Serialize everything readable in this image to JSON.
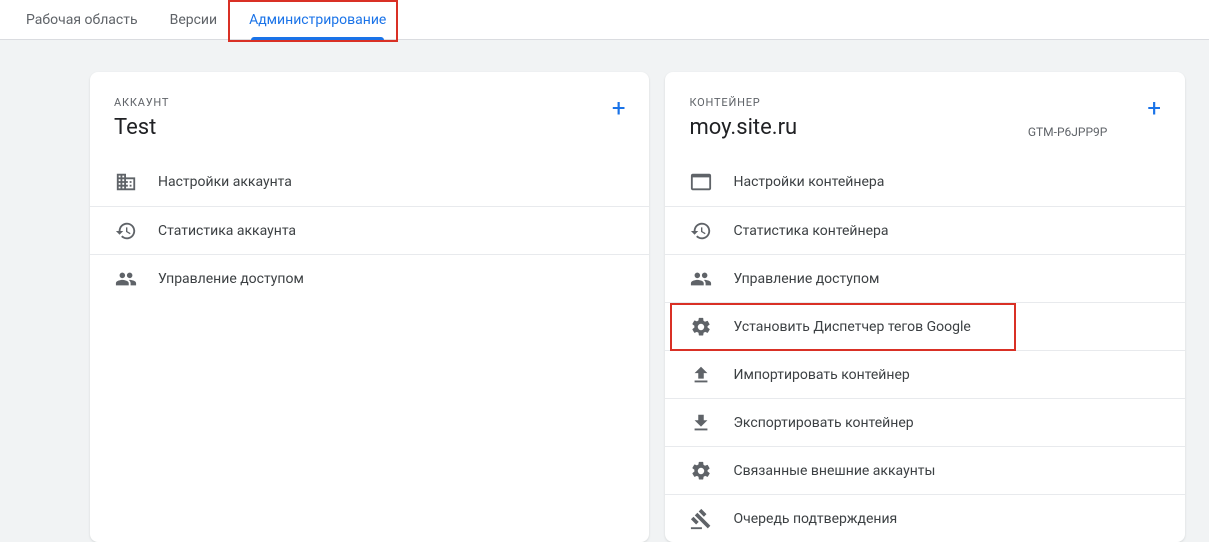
{
  "tabs": {
    "workspace": "Рабочая область",
    "versions": "Версии",
    "admin": "Администрирование"
  },
  "account": {
    "section_label": "АККАУНТ",
    "title": "Test",
    "items": [
      {
        "label": "Настройки аккаунта"
      },
      {
        "label": "Статистика аккаунта"
      },
      {
        "label": "Управление доступом"
      }
    ]
  },
  "container": {
    "section_label": "КОНТЕЙНЕР",
    "title": "moy.site.ru",
    "id": "GTM-P6JPP9P",
    "items": [
      {
        "label": "Настройки контейнера"
      },
      {
        "label": "Статистика контейнера"
      },
      {
        "label": "Управление доступом"
      },
      {
        "label": "Установить Диспетчер тегов Google"
      },
      {
        "label": "Импортировать контейнер"
      },
      {
        "label": "Экспортировать контейнер"
      },
      {
        "label": "Связанные внешние аккаунты"
      },
      {
        "label": "Очередь подтверждения"
      }
    ]
  },
  "plus": "+"
}
